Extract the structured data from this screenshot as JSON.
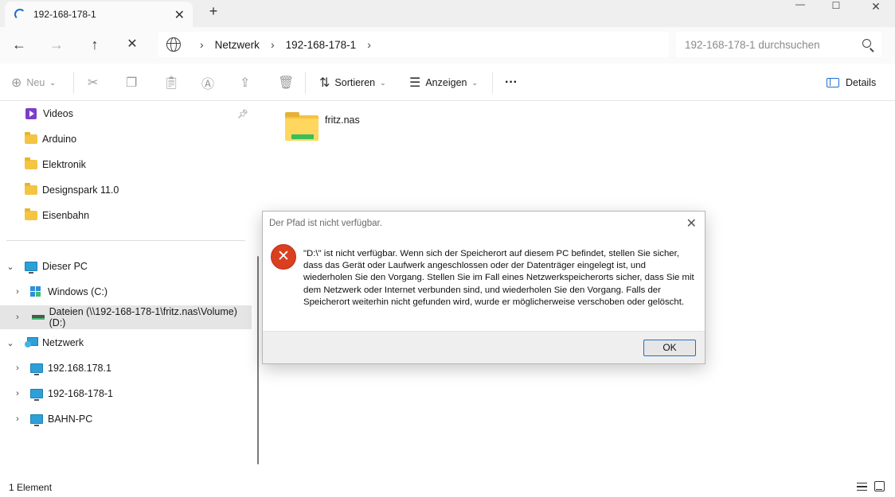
{
  "tab": {
    "title": "192-168-178-1",
    "close": "✕",
    "new": "+"
  },
  "window_controls": {
    "min": "—",
    "max": "☐",
    "close": "✕"
  },
  "nav": {
    "back": "←",
    "forward": "→",
    "up": "↑",
    "stop": "✕"
  },
  "breadcrumb": {
    "sep": "›",
    "items": [
      "Netzwerk",
      "192-168-178-1"
    ]
  },
  "search": {
    "placeholder": "192-168-178-1 durchsuchen"
  },
  "toolbar": {
    "new_label": "Neu",
    "sort_label": "Sortieren",
    "view_label": "Anzeigen",
    "more": "···",
    "details_label": "Details"
  },
  "sidebar": {
    "quick_access": [
      {
        "label": "Videos",
        "icon": "video-icon",
        "pinned": true
      },
      {
        "label": "Arduino",
        "icon": "folder-icon"
      },
      {
        "label": "Elektronik",
        "icon": "folder-icon"
      },
      {
        "label": "Designspark 11.0",
        "icon": "folder-icon"
      },
      {
        "label": "Eisenbahn",
        "icon": "folder-icon"
      }
    ],
    "this_pc": {
      "label": "Dieser PC",
      "expanded": true
    },
    "drives": [
      {
        "label": "Windows (C:)",
        "icon": "windows-drive-icon"
      },
      {
        "label": "Dateien (\\\\192-168-178-1\\fritz.nas\\Volume) (D:)",
        "icon": "network-drive-icon",
        "selected": true
      }
    ],
    "network": {
      "label": "Netzwerk",
      "expanded": true
    },
    "network_items": [
      {
        "label": "192.168.178.1"
      },
      {
        "label": "192-168-178-1"
      },
      {
        "label": "BAHN-PC"
      }
    ]
  },
  "content": {
    "items": [
      {
        "name": "fritz.nas",
        "icon": "network-folder-icon"
      }
    ]
  },
  "status": {
    "count": "1 Element"
  },
  "dialog": {
    "title": "Der Pfad ist nicht verfügbar.",
    "message": "\"D:\\\" ist nicht verfügbar. Wenn sich der Speicherort auf diesem PC befindet, stellen Sie sicher, dass das Gerät oder Laufwerk angeschlossen oder der Datenträger eingelegt ist, und wiederholen Sie den Vorgang. Stellen Sie im Fall eines Netzwerkspeicherorts sicher, dass Sie mit dem Netzwerk oder Internet verbunden sind, und wiederholen Sie den Vorgang. Falls der Speicherort weiterhin nicht gefunden wird, wurde er möglicherweise verschoben oder gelöscht.",
    "ok_label": "OK",
    "close": "✕",
    "error_glyph": "✕"
  },
  "colors": {
    "accent": "#1c6fd1",
    "error": "#d9401f",
    "folder": "#f5c343",
    "selection": "#e5e5e5"
  }
}
